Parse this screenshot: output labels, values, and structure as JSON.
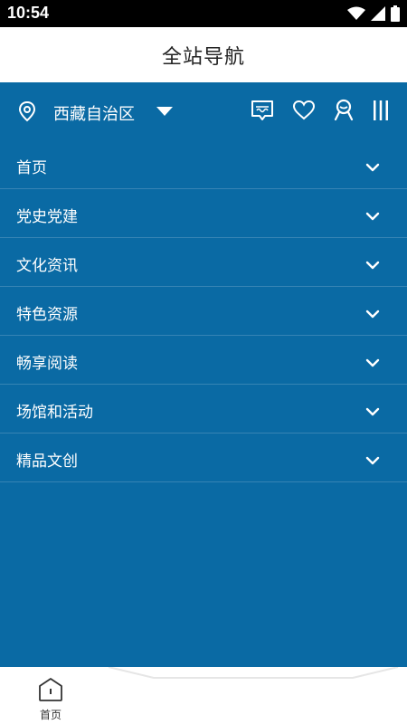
{
  "status_bar": {
    "time": "10:54"
  },
  "header": {
    "title": "全站导航"
  },
  "location": {
    "region": "西藏自治区"
  },
  "menu": {
    "items": [
      {
        "label": "首页"
      },
      {
        "label": "党史党建"
      },
      {
        "label": "文化资讯"
      },
      {
        "label": "特色资源"
      },
      {
        "label": "畅享阅读"
      },
      {
        "label": "场馆和活动"
      },
      {
        "label": "精品文创"
      }
    ]
  },
  "tabbar": {
    "home_label": "首页"
  },
  "colors": {
    "panel": "#0a6aa4",
    "divider": "rgba(255,255,255,0.18)",
    "text_light": "#ffffff",
    "title_text": "#222222"
  },
  "icons": [
    "location-pin-icon",
    "caret-down-icon",
    "tibetan-chat-icon",
    "heart-icon",
    "user-icon",
    "columns-menu-icon",
    "chevron-down-icon",
    "home-icon",
    "wifi-icon",
    "signal-icon",
    "battery-icon"
  ]
}
